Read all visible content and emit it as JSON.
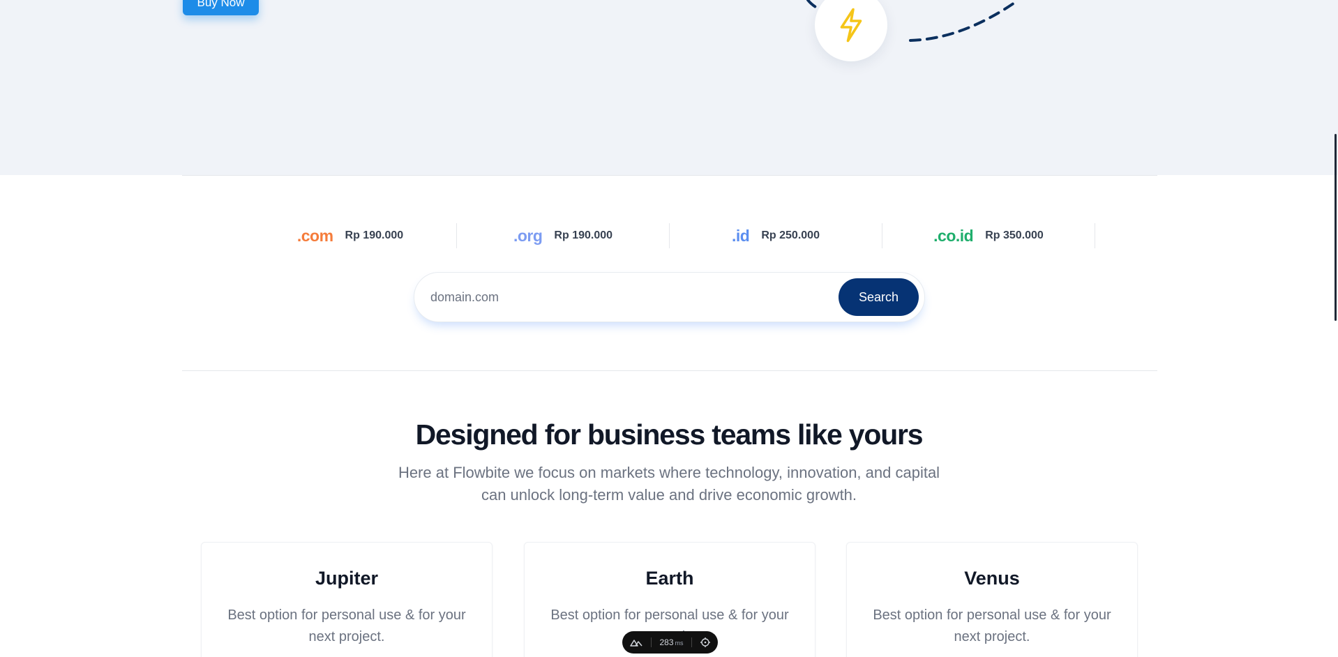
{
  "hero": {
    "buy_label": "Buy Now",
    "icon": "lightning-bolt-icon"
  },
  "domains": [
    {
      "tld": ".com",
      "price": "Rp 190.000",
      "color": "#f57c3b"
    },
    {
      "tld": ".org",
      "price": "Rp 190.000",
      "color": "#7c9cf2"
    },
    {
      "tld": ".id",
      "price": "Rp 250.000",
      "color": "#5b8ef0"
    },
    {
      "tld": ".co.id",
      "price": "Rp 350.000",
      "color": "#1fae6c"
    }
  ],
  "search": {
    "placeholder": "domain.com",
    "button_label": "Search"
  },
  "section": {
    "title": "Designed for business teams like yours",
    "subtitle": "Here at Flowbite we focus on markets where technology, innovation, and capital can unlock long-term value and drive economic growth."
  },
  "plans": [
    {
      "name": "Jupiter",
      "description": "Best option for personal use & for your next project."
    },
    {
      "name": "Earth",
      "description": "Best option for personal use & for your next project."
    },
    {
      "name": "Venus",
      "description": "Best option for personal use & for your next project."
    }
  ],
  "devbar": {
    "timing": "283",
    "unit": "ms"
  },
  "colors": {
    "primary_button": "#1d8ce8",
    "search_button": "#063374",
    "hero_background": "#f0f3f8",
    "bolt": "#f5c518"
  }
}
